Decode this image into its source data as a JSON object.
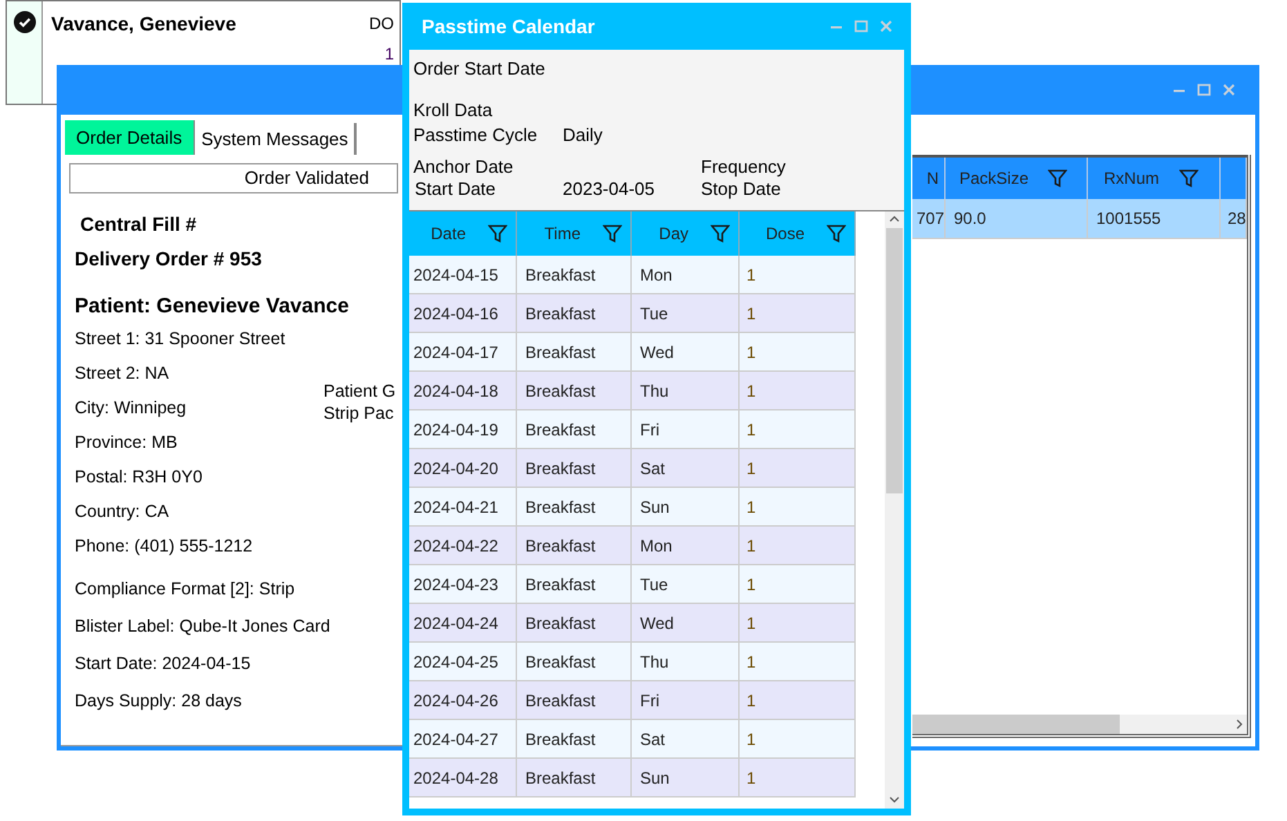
{
  "background_card": {
    "checked": true,
    "name": "Vavance, Genevieve",
    "code": "DO",
    "count": "1"
  },
  "main_window": {
    "tabs": [
      {
        "label": "Order Details",
        "selected": true
      },
      {
        "label": "System Messages",
        "selected": false
      }
    ],
    "status": "Order Validated",
    "central_fill": "Central Fill #",
    "delivery_order": "Delivery Order # 953",
    "patient": "Patient: Genevieve Vavance",
    "address_lines": [
      "Street 1: 31 Spooner Street",
      "Street 2: NA",
      "City: Winnipeg",
      "Province: MB",
      "Postal: R3H 0Y0",
      "Country: CA",
      "Phone: (401) 555-1212"
    ],
    "side_lines": [
      "Patient G",
      "Strip Pac"
    ],
    "format_lines": [
      "Compliance Format [2]: Strip",
      "Blister Label: Qube-It Jones Card",
      "Start Date: 2024-04-15",
      "Days Supply: 28 days"
    ],
    "grid": {
      "columns": [
        {
          "label": "N",
          "filter": false
        },
        {
          "label": "PackSize",
          "filter": true
        },
        {
          "label": "RxNum",
          "filter": true
        },
        {
          "filter": false
        }
      ],
      "rows": [
        {
          "cells": [
            "707",
            "90.0",
            "1001555",
            "28"
          ],
          "selected": true
        }
      ]
    }
  },
  "passtime_window": {
    "title": "Passtime Calendar",
    "order_start_date": "Order Start Date",
    "kroll_data": "Kroll Data",
    "cycle_label": "Passtime Cycle",
    "cycle_value": "Daily",
    "anchor_date": "Anchor Date",
    "frequency": "Frequency",
    "start_date_label": "Start Date",
    "start_date_value": "2023-04-05",
    "stop_date": "Stop Date",
    "grid": {
      "columns": [
        {
          "label": "Date",
          "filter": true
        },
        {
          "label": "Time",
          "filter": true
        },
        {
          "label": "Day",
          "filter": true
        },
        {
          "label": "Dose",
          "filter": true
        }
      ],
      "rows": [
        {
          "cells": [
            "2024-04-15",
            "Breakfast",
            "Mon",
            "1"
          ]
        },
        {
          "cells": [
            "2024-04-16",
            "Breakfast",
            "Tue",
            "1"
          ]
        },
        {
          "cells": [
            "2024-04-17",
            "Breakfast",
            "Wed",
            "1"
          ]
        },
        {
          "cells": [
            "2024-04-18",
            "Breakfast",
            "Thu",
            "1"
          ]
        },
        {
          "cells": [
            "2024-04-19",
            "Breakfast",
            "Fri",
            "1"
          ]
        },
        {
          "cells": [
            "2024-04-20",
            "Breakfast",
            "Sat",
            "1"
          ]
        },
        {
          "cells": [
            "2024-04-21",
            "Breakfast",
            "Sun",
            "1"
          ]
        },
        {
          "cells": [
            "2024-04-22",
            "Breakfast",
            "Mon",
            "1"
          ]
        },
        {
          "cells": [
            "2024-04-23",
            "Breakfast",
            "Tue",
            "1"
          ]
        },
        {
          "cells": [
            "2024-04-24",
            "Breakfast",
            "Wed",
            "1"
          ]
        },
        {
          "cells": [
            "2024-04-25",
            "Breakfast",
            "Thu",
            "1"
          ]
        },
        {
          "cells": [
            "2024-04-26",
            "Breakfast",
            "Fri",
            "1"
          ]
        },
        {
          "cells": [
            "2024-04-27",
            "Breakfast",
            "Sat",
            "1"
          ]
        },
        {
          "cells": [
            "2024-04-28",
            "Breakfast",
            "Sun",
            "1"
          ]
        }
      ]
    }
  }
}
